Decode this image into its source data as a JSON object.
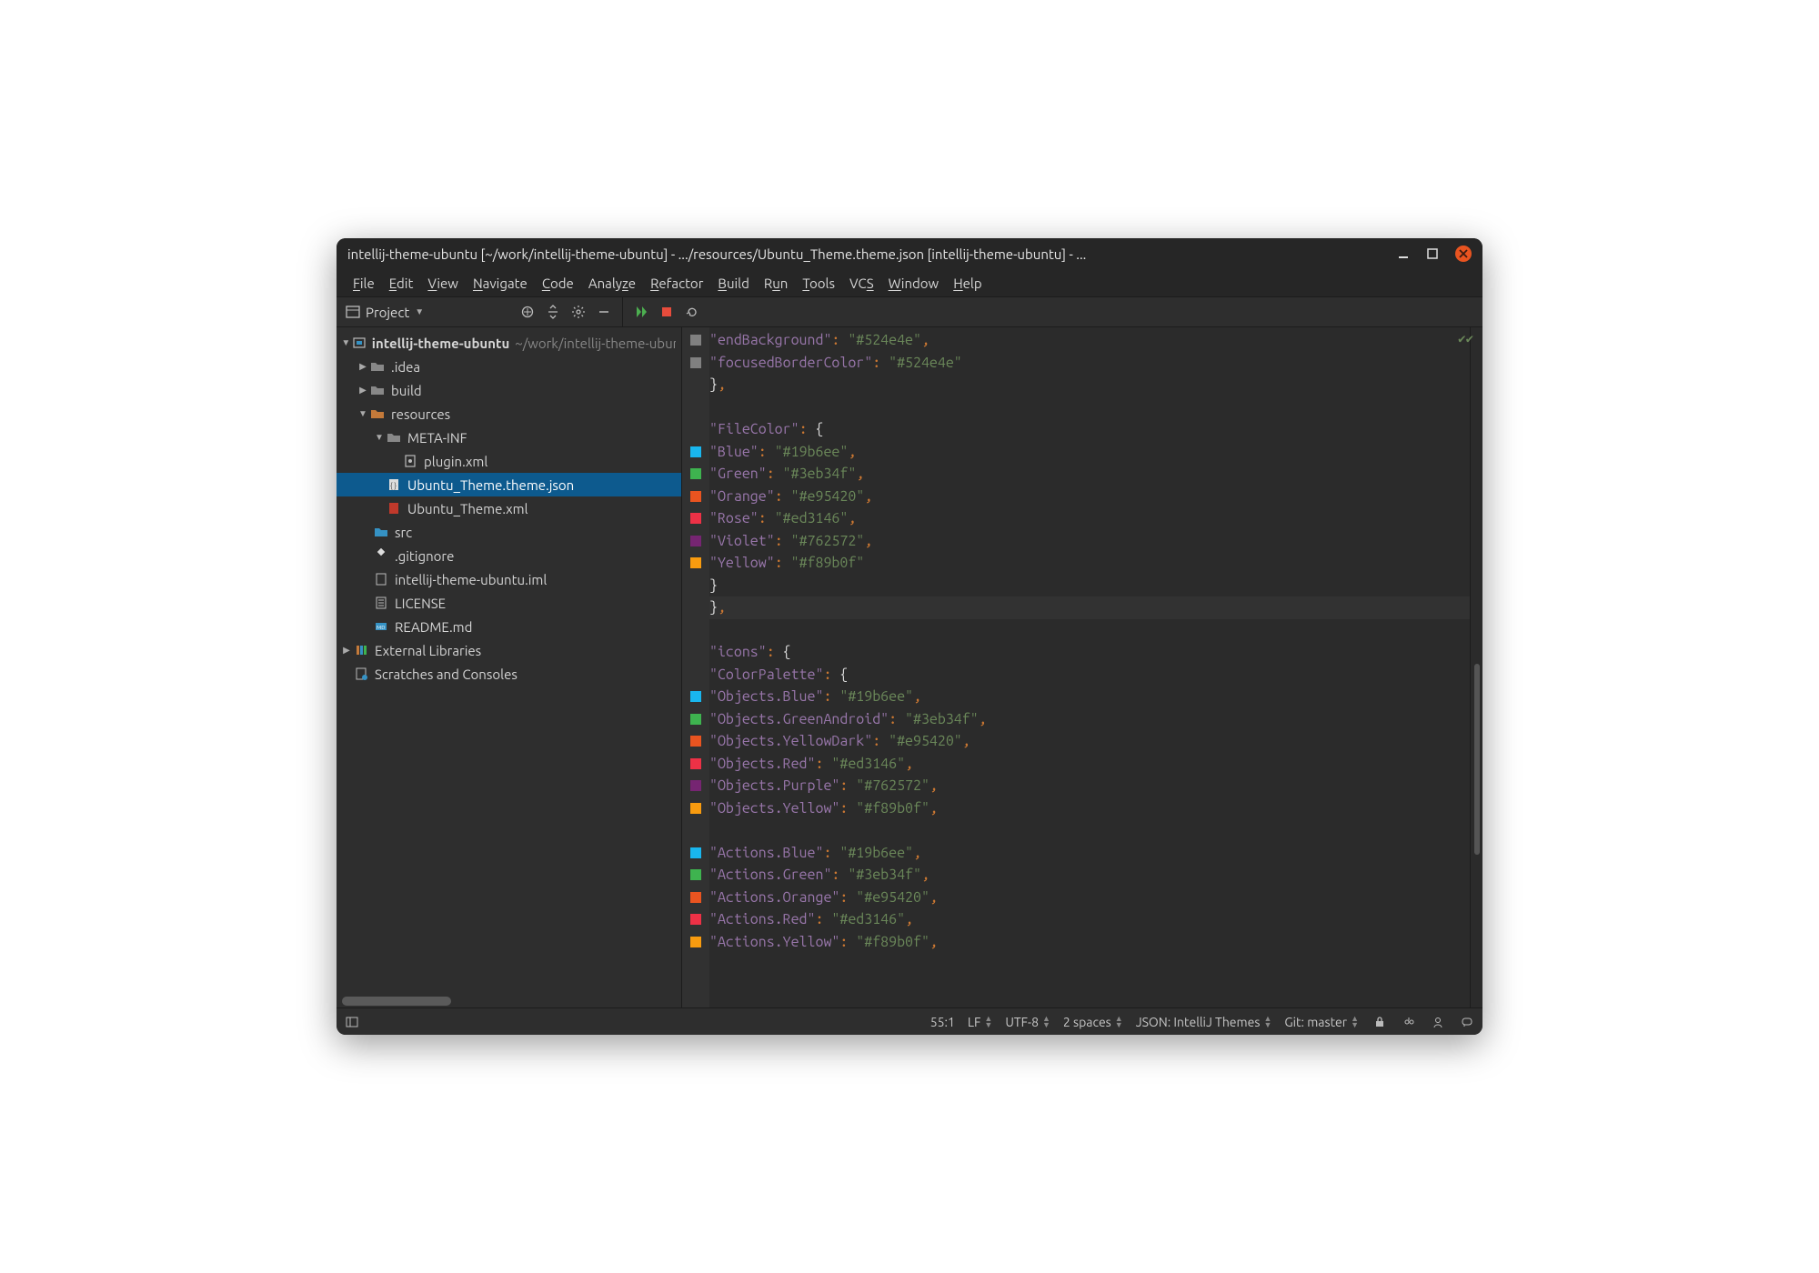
{
  "window": {
    "title": "intellij-theme-ubuntu [~/work/intellij-theme-ubuntu] - .../resources/Ubuntu_Theme.theme.json [intellij-theme-ubuntu] - ..."
  },
  "menu": {
    "file": "File",
    "edit": "Edit",
    "view": "View",
    "navigate": "Navigate",
    "code": "Code",
    "analyze": "Analyze",
    "refactor": "Refactor",
    "build": "Build",
    "run": "Run",
    "tools": "Tools",
    "vcs": "VCS",
    "window": "Window",
    "help": "Help"
  },
  "toolwindow": {
    "project_label": "Project"
  },
  "tree": {
    "root_name": "intellij-theme-ubuntu",
    "root_path": "~/work/intellij-theme-ubuntu",
    "idea": ".idea",
    "build": "build",
    "resources": "resources",
    "metainf": "META-INF",
    "pluginxml": "plugin.xml",
    "themejson": "Ubuntu_Theme.theme.json",
    "themexml": "Ubuntu_Theme.xml",
    "src": "src",
    "gitignore": ".gitignore",
    "iml": "intellij-theme-ubuntu.iml",
    "license": "LICENSE",
    "readme": "README.md",
    "extlib": "External Libraries",
    "scratches": "Scratches and Consoles"
  },
  "code": {
    "k_endBackground": "\"endBackground\"",
    "v_endBackground": "\"#524e4e\"",
    "k_focusedBorderColor": "\"focusedBorderColor\"",
    "v_focusedBorderColor": "\"#524e4e\"",
    "k_FileColor": "\"FileColor\"",
    "k_Blue": "\"Blue\"",
    "v_Blue": "\"#19b6ee\"",
    "k_Green": "\"Green\"",
    "v_Green": "\"#3eb34f\"",
    "k_Orange": "\"Orange\"",
    "v_Orange": "\"#e95420\"",
    "k_Rose": "\"Rose\"",
    "v_Rose": "\"#ed3146\"",
    "k_Violet": "\"Violet\"",
    "v_Violet": "\"#762572\"",
    "k_Yellow": "\"Yellow\"",
    "v_Yellow": "\"#f89b0f\"",
    "k_icons": "\"icons\"",
    "k_ColorPalette": "\"ColorPalette\"",
    "k_ObjBlue": "\"Objects.Blue\"",
    "v_ObjBlue": "\"#19b6ee\"",
    "k_ObjGreenAndroid": "\"Objects.GreenAndroid\"",
    "v_ObjGreenAndroid": "\"#3eb34f\"",
    "k_ObjYellowDark": "\"Objects.YellowDark\"",
    "v_ObjYellowDark": "\"#e95420\"",
    "k_ObjRed": "\"Objects.Red\"",
    "v_ObjRed": "\"#ed3146\"",
    "k_ObjPurple": "\"Objects.Purple\"",
    "v_ObjPurple": "\"#762572\"",
    "k_ObjYellow": "\"Objects.Yellow\"",
    "v_ObjYellow": "\"#f89b0f\"",
    "k_ActBlue": "\"Actions.Blue\"",
    "v_ActBlue": "\"#19b6ee\"",
    "k_ActGreen": "\"Actions.Green\"",
    "v_ActGreen": "\"#3eb34f\"",
    "k_ActOrange": "\"Actions.Orange\"",
    "v_ActOrange": "\"#e95420\"",
    "k_ActRed": "\"Actions.Red\"",
    "v_ActRed": "\"#ed3146\"",
    "k_ActYellow": "\"Actions.Yellow\"",
    "v_ActYellow": "\"#f89b0f\""
  },
  "swatches": {
    "blue": "#19b6ee",
    "green": "#3eb34f",
    "orange": "#e95420",
    "rose": "#ed3146",
    "violet": "#762572",
    "yellow": "#f89b0f",
    "grey": "#808080"
  },
  "status": {
    "pos": "55:1",
    "lineend": "LF",
    "encoding": "UTF-8",
    "indent": "2 spaces",
    "filetype": "JSON: IntelliJ Themes",
    "git": "Git: master"
  }
}
